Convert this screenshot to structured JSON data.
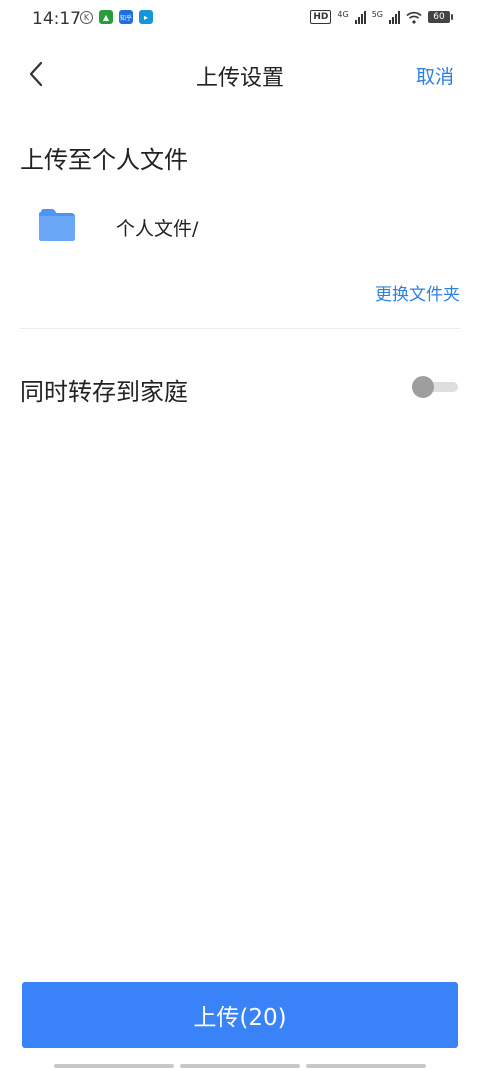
{
  "status_bar": {
    "time": "14:17",
    "app_icons": [
      "k-icon",
      "green-app-icon",
      "zhihu-icon",
      "blue-app-icon"
    ],
    "zhihu_text": "知乎",
    "hd_tag": "HD",
    "sim1_network": "4G",
    "sim2_network": "5G",
    "battery": "60"
  },
  "header": {
    "title": "上传设置",
    "cancel_label": "取消"
  },
  "destination": {
    "section_title": "上传至个人文件",
    "folder_path": "个人文件/",
    "change_folder_label": "更换文件夹"
  },
  "family_option": {
    "label": "同时转存到家庭",
    "enabled": false
  },
  "upload_button": {
    "label": "上传(20)"
  },
  "colors": {
    "accent": "#2f7fe0",
    "button": "#3a82f7",
    "folder": "#5b9cf5"
  }
}
